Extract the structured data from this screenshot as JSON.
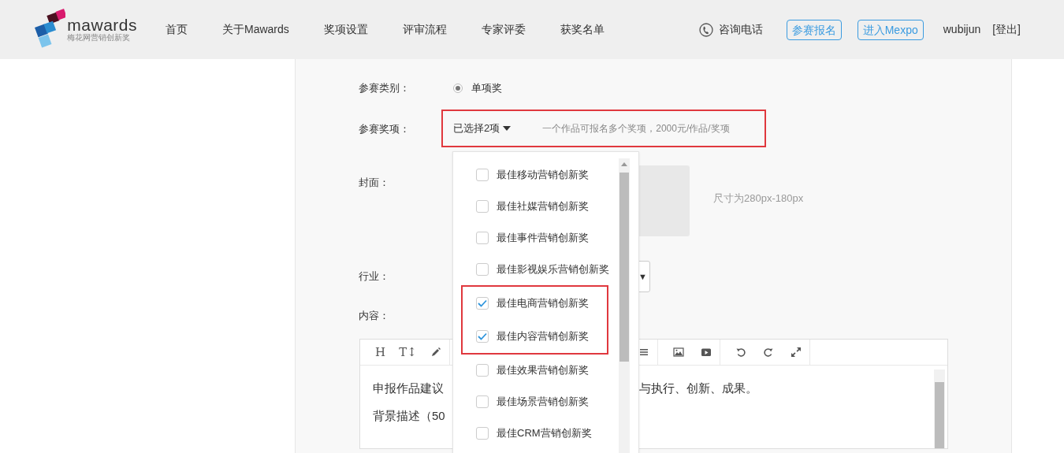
{
  "header": {
    "logo": {
      "wordmark": "mawards",
      "tagline": "梅花网营销创新奖"
    },
    "nav": [
      {
        "label": "首页"
      },
      {
        "label": "关于Mawards"
      },
      {
        "label": "奖项设置"
      },
      {
        "label": "评审流程"
      },
      {
        "label": "专家评委"
      },
      {
        "label": "获奖名单"
      }
    ],
    "phone_label": "咨询电话",
    "buttons": [
      {
        "label": "参赛报名"
      },
      {
        "label": "进入Mexpo"
      }
    ],
    "username": "wubijun",
    "logout": "[登出]"
  },
  "form": {
    "category": {
      "label": "参赛类别：",
      "option": {
        "label": "单项奖",
        "selected": true
      }
    },
    "award": {
      "label": "参赛奖项：",
      "summary": "已选择2项",
      "hint": "一个作品可报名多个奖项，2000元/作品/奖项",
      "highlighted": true,
      "expanded": true,
      "highlight_checked": true,
      "options": [
        {
          "label": "最佳移动营销创新奖",
          "checked": false
        },
        {
          "label": "最佳社媒营销创新奖",
          "checked": false
        },
        {
          "label": "最佳事件营销创新奖",
          "checked": false
        },
        {
          "label": "最佳影视娱乐营销创新奖",
          "checked": false
        },
        {
          "label": "最佳电商营销创新奖",
          "checked": true
        },
        {
          "label": "最佳内容营销创新奖",
          "checked": true
        },
        {
          "label": "最佳效果营销创新奖",
          "checked": false
        },
        {
          "label": "最佳场景营销创新奖",
          "checked": false
        },
        {
          "label": "最佳CRM营销创新奖",
          "checked": false
        }
      ]
    },
    "cover": {
      "label": "封面：",
      "hint": "尺寸为280px-180px"
    },
    "industry": {
      "label": "行业：",
      "caret": "▼"
    },
    "content": {
      "label": "内容：",
      "toolbar": [
        [
          {
            "kind": "glyph",
            "text": "H"
          },
          {
            "kind": "glyph",
            "text": "T↕"
          },
          {
            "kind": "pencil"
          }
        ],
        [
          {
            "kind": "list"
          }
        ],
        [
          {
            "kind": "image"
          },
          {
            "kind": "video"
          }
        ],
        [
          {
            "kind": "undo"
          },
          {
            "kind": "redo"
          },
          {
            "kind": "fullscreen"
          }
        ]
      ],
      "lines": [
        {
          "left": "申报作品建议",
          "right": "与执行、创新、成果。"
        },
        {
          "left": "背景描述（50"
        }
      ]
    }
  }
}
